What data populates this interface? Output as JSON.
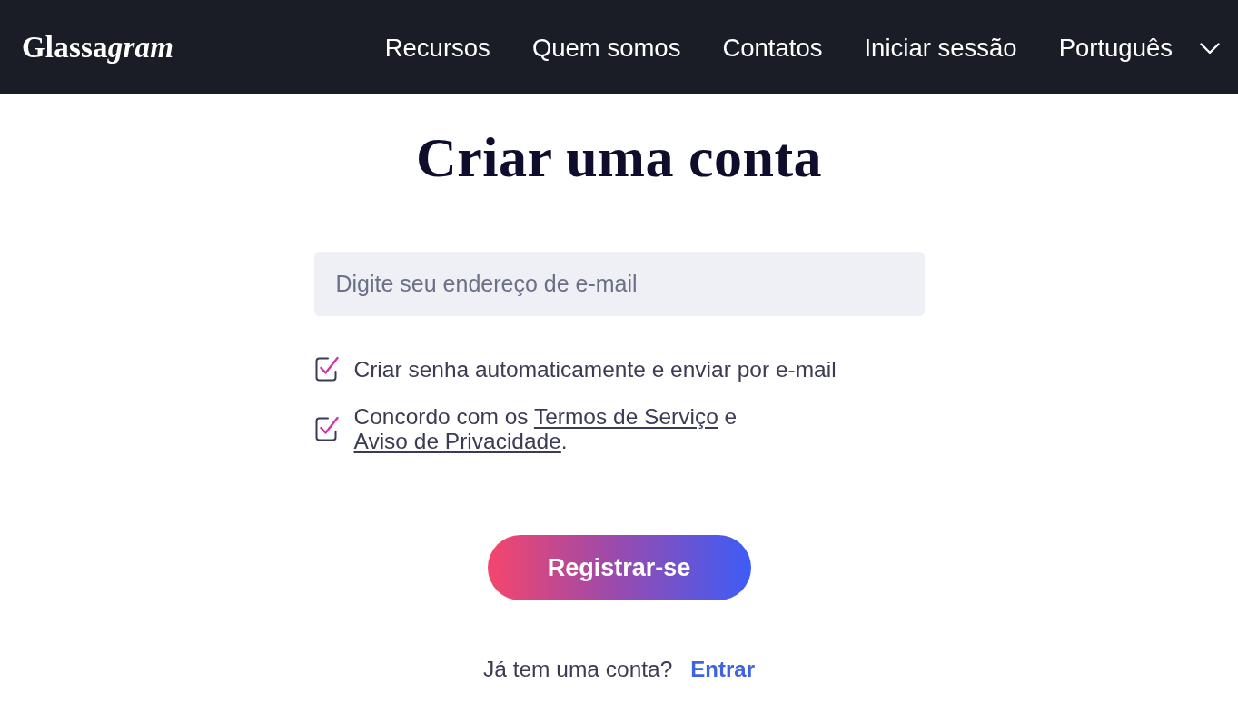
{
  "header": {
    "logo": {
      "bold": "Glassa",
      "italic": "gram"
    },
    "nav_links": [
      "Recursos",
      "Quem somos",
      "Contatos",
      "Iniciar sessão"
    ],
    "language": {
      "label": "Português"
    }
  },
  "form": {
    "title": "Criar uma conta",
    "email": {
      "placeholder": "Digite seu endereço de e-mail"
    },
    "options": [
      {
        "kind": "plain",
        "checked": true,
        "label": "Criar senha automaticamente e enviar por e-mail"
      },
      {
        "kind": "agreement",
        "checked": true,
        "parts": [
          {
            "kind": "text",
            "text": "Concordo com os "
          },
          {
            "kind": "link",
            "text": "Termos de Serviço"
          },
          {
            "kind": "text",
            "text": " e "
          },
          {
            "kind": "link",
            "text": "Aviso de Privacidade"
          },
          {
            "kind": "text",
            "text": "."
          }
        ]
      }
    ],
    "submit": "Registrar-se",
    "signin": {
      "prompt": "Já tem uma conta?",
      "link": "Entrar"
    }
  }
}
